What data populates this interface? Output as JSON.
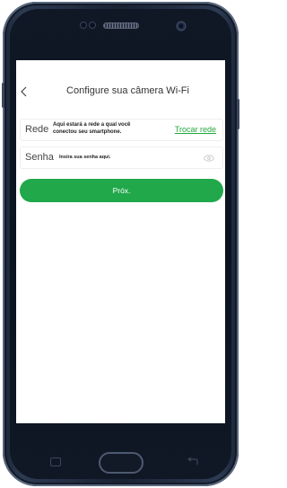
{
  "header": {
    "title": "Configure sua câmera Wi-Fi",
    "back_icon": "chevron-left-icon"
  },
  "network_row": {
    "label": "Rede",
    "hint": "Aqui estará a rede a qual você conectou seu smartphone.",
    "hint_line1": "Aqui estará a rede a qual você",
    "hint_line2": "conectou seu smartphone.",
    "change_label": "Trocar rede"
  },
  "password_row": {
    "label": "Senha",
    "placeholder": "Insira sua senha aqui.",
    "value": "",
    "toggle_icon": "eye-icon"
  },
  "next_button": {
    "label": "Próx."
  },
  "colors": {
    "accent": "#20a84a",
    "link": "#24a83f"
  }
}
